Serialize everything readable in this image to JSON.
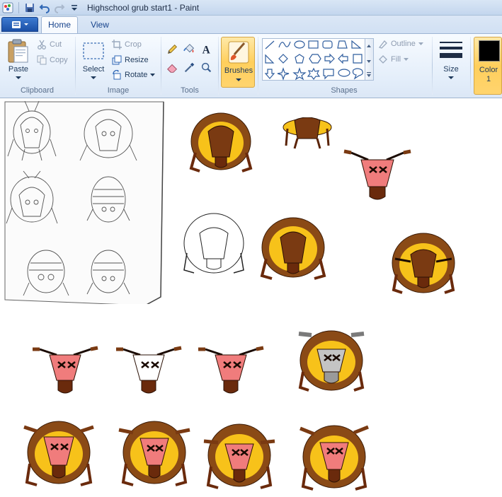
{
  "window": {
    "title": "Highschool grub start1 - Paint"
  },
  "tabs": {
    "home": "Home",
    "view": "View"
  },
  "clipboard": {
    "group_label": "Clipboard",
    "paste": "Paste",
    "cut": "Cut",
    "copy": "Copy"
  },
  "image": {
    "group_label": "Image",
    "select": "Select",
    "crop": "Crop",
    "resize": "Resize",
    "rotate": "Rotate"
  },
  "tools": {
    "group_label": "Tools",
    "icons": [
      "pencil-icon",
      "fill-icon",
      "text-icon",
      "eraser-icon",
      "color-picker-icon",
      "magnifier-icon"
    ]
  },
  "brushes": {
    "label": "Brushes"
  },
  "shapes": {
    "group_label": "Shapes",
    "outline": "Outline",
    "fill": "Fill"
  },
  "size": {
    "label": "Size"
  },
  "color1": {
    "label_line1": "Color",
    "label_line2": "1",
    "value": "#000000"
  },
  "colors": {
    "ribbon_bg": "#e4eefa",
    "accent_blue": "#15428b",
    "brush_highlight": "#ffcf5c",
    "grub_brown": "#7a3a12",
    "grub_yellow": "#f7c21a",
    "grub_pink": "#f07c7c",
    "grub_gray": "#c4c4c4"
  }
}
